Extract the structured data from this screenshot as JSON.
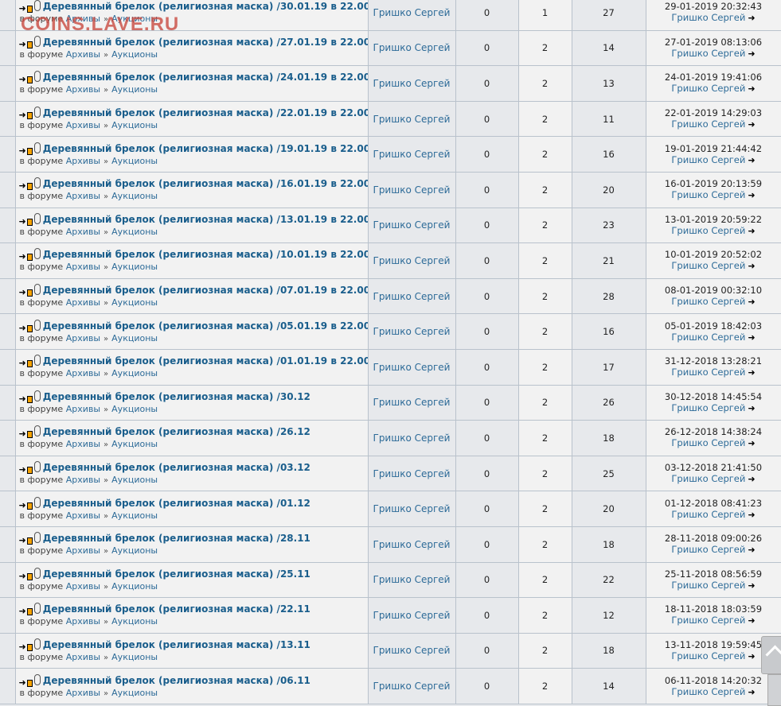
{
  "watermark": "COINS.LAVE.RU",
  "labels": {
    "in_forum": "в форуме",
    "sep": "»"
  },
  "icons": [
    "arrow-right-icon",
    "new-post-icon",
    "paperclip-icon",
    "goto-last-post-icon",
    "scroll-to-top-icon"
  ],
  "topics": [
    {
      "title": "Деревянный брелок (религиозная маска) /30.01.19 в 22.00",
      "forum": "Архивы",
      "subforum": "Аукционы",
      "author": "Гришко Сергей",
      "replies": "0",
      "c2": "1",
      "views": "27",
      "last_date": "29-01-2019 20:32:43",
      "last_user": "Гришко Сергей"
    },
    {
      "title": "Деревянный брелок (религиозная маска) /27.01.19 в 22.00",
      "forum": "Архивы",
      "subforum": "Аукционы",
      "author": "Гришко Сергей",
      "replies": "0",
      "c2": "2",
      "views": "14",
      "last_date": "27-01-2019 08:13:06",
      "last_user": "Гришко Сергей"
    },
    {
      "title": "Деревянный брелок (религиозная маска) /24.01.19 в 22.00",
      "forum": "Архивы",
      "subforum": "Аукционы",
      "author": "Гришко Сергей",
      "replies": "0",
      "c2": "2",
      "views": "13",
      "last_date": "24-01-2019 19:41:06",
      "last_user": "Гришко Сергей"
    },
    {
      "title": "Деревянный брелок (религиозная маска) /22.01.19 в 22.00",
      "forum": "Архивы",
      "subforum": "Аукционы",
      "author": "Гришко Сергей",
      "replies": "0",
      "c2": "2",
      "views": "11",
      "last_date": "22-01-2019 14:29:03",
      "last_user": "Гришко Сергей"
    },
    {
      "title": "Деревянный брелок (религиозная маска) /19.01.19 в 22.00",
      "forum": "Архивы",
      "subforum": "Аукционы",
      "author": "Гришко Сергей",
      "replies": "0",
      "c2": "2",
      "views": "16",
      "last_date": "19-01-2019 21:44:42",
      "last_user": "Гришко Сергей"
    },
    {
      "title": "Деревянный брелок (религиозная маска) /16.01.19 в 22.00",
      "forum": "Архивы",
      "subforum": "Аукционы",
      "author": "Гришко Сергей",
      "replies": "0",
      "c2": "2",
      "views": "20",
      "last_date": "16-01-2019 20:13:59",
      "last_user": "Гришко Сергей"
    },
    {
      "title": "Деревянный брелок (религиозная маска) /13.01.19 в 22.00",
      "forum": "Архивы",
      "subforum": "Аукционы",
      "author": "Гришко Сергей",
      "replies": "0",
      "c2": "2",
      "views": "23",
      "last_date": "13-01-2019 20:59:22",
      "last_user": "Гришко Сергей"
    },
    {
      "title": "Деревянный брелок (религиозная маска) /10.01.19 в 22.00",
      "forum": "Архивы",
      "subforum": "Аукционы",
      "author": "Гришко Сергей",
      "replies": "0",
      "c2": "2",
      "views": "21",
      "last_date": "10-01-2019 20:52:02",
      "last_user": "Гришко Сергей"
    },
    {
      "title": "Деревянный брелок (религиозная маска) /07.01.19 в 22.00",
      "forum": "Архивы",
      "subforum": "Аукционы",
      "author": "Гришко Сергей",
      "replies": "0",
      "c2": "2",
      "views": "28",
      "last_date": "08-01-2019 00:32:10",
      "last_user": "Гришко Сергей"
    },
    {
      "title": "Деревянный брелок (религиозная маска) /05.01.19 в 22.00",
      "forum": "Архивы",
      "subforum": "Аукционы",
      "author": "Гришко Сергей",
      "replies": "0",
      "c2": "2",
      "views": "16",
      "last_date": "05-01-2019 18:42:03",
      "last_user": "Гришко Сергей"
    },
    {
      "title": "Деревянный брелок (религиозная маска) /01.01.19 в 22.00",
      "forum": "Архивы",
      "subforum": "Аукционы",
      "author": "Гришко Сергей",
      "replies": "0",
      "c2": "2",
      "views": "17",
      "last_date": "31-12-2018 13:28:21",
      "last_user": "Гришко Сергей"
    },
    {
      "title": "Деревянный брелок (религиозная маска) /30.12",
      "forum": "Архивы",
      "subforum": "Аукционы",
      "author": "Гришко Сергей",
      "replies": "0",
      "c2": "2",
      "views": "26",
      "last_date": "30-12-2018 14:45:54",
      "last_user": "Гришко Сергей"
    },
    {
      "title": "Деревянный брелок (религиозная маска) /26.12",
      "forum": "Архивы",
      "subforum": "Аукционы",
      "author": "Гришко Сергей",
      "replies": "0",
      "c2": "2",
      "views": "18",
      "last_date": "26-12-2018 14:38:24",
      "last_user": "Гришко Сергей"
    },
    {
      "title": "Деревянный брелок (религиозная маска) /03.12",
      "forum": "Архивы",
      "subforum": "Аукционы",
      "author": "Гришко Сергей",
      "replies": "0",
      "c2": "2",
      "views": "25",
      "last_date": "03-12-2018 21:41:50",
      "last_user": "Гришко Сергей"
    },
    {
      "title": "Деревянный брелок (религиозная маска) /01.12",
      "forum": "Архивы",
      "subforum": "Аукционы",
      "author": "Гришко Сергей",
      "replies": "0",
      "c2": "2",
      "views": "20",
      "last_date": "01-12-2018 08:41:23",
      "last_user": "Гришко Сергей"
    },
    {
      "title": "Деревянный брелок (религиозная маска) /28.11",
      "forum": "Архивы",
      "subforum": "Аукционы",
      "author": "Гришко Сергей",
      "replies": "0",
      "c2": "2",
      "views": "18",
      "last_date": "28-11-2018 09:00:26",
      "last_user": "Гришко Сергей"
    },
    {
      "title": "Деревянный брелок (религиозная маска) /25.11",
      "forum": "Архивы",
      "subforum": "Аукционы",
      "author": "Гришко Сергей",
      "replies": "0",
      "c2": "2",
      "views": "22",
      "last_date": "25-11-2018 08:56:59",
      "last_user": "Гришко Сергей"
    },
    {
      "title": "Деревянный брелок (религиозная маска) /22.11",
      "forum": "Архивы",
      "subforum": "Аукционы",
      "author": "Гришко Сергей",
      "replies": "0",
      "c2": "2",
      "views": "12",
      "last_date": "18-11-2018 18:03:59",
      "last_user": "Гришко Сергей"
    },
    {
      "title": "Деревянный брелок (религиозная маска) /13.11",
      "forum": "Архивы",
      "subforum": "Аукционы",
      "author": "Гришко Сергей",
      "replies": "0",
      "c2": "2",
      "views": "18",
      "last_date": "13-11-2018 19:59:45",
      "last_user": "Гришко Сергей"
    },
    {
      "title": "Деревянный брелок (религиозная маска) /06.11",
      "forum": "Архивы",
      "subforum": "Аукционы",
      "author": "Гришко Сергей",
      "replies": "0",
      "c2": "2",
      "views": "14",
      "last_date": "06-11-2018 14:20:32",
      "last_user": "Гришко Сергей"
    }
  ]
}
